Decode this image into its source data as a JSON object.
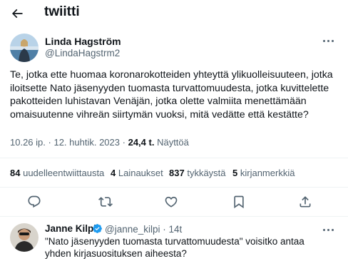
{
  "header": {
    "title": "twiitti",
    "back_icon": "arrow-left-icon"
  },
  "tweet": {
    "author": {
      "name": "Linda Hagström",
      "handle": "@LindaHagstrm2"
    },
    "text": "Te, jotka ette huomaa  koronarokotteiden yhteyttä ylikuolleisuuteen, jotka iloitsette Nato jäsenyyden tuomasta turvattomuudesta, jotka kuvittelette pakotteiden luhistavan Venäjän, jotka olette valmiita menettämään omaisuutenne vihreän siirtymän vuoksi, mitä vedätte että kestätte?",
    "time": "10.26 ip.",
    "date": "12. huhtik. 2023",
    "separator": "·",
    "views_count": "24,4 t.",
    "views_label": "Näyttöä",
    "stats": {
      "retweets_count": "84",
      "retweets_label": "uudelleentwiittausta",
      "quotes_count": "4",
      "quotes_label": "Lainaukset",
      "likes_count": "837",
      "likes_label": "tykkäystä",
      "bookmarks_count": "5",
      "bookmarks_label": "kirjanmerkkiä"
    },
    "actions": [
      "reply-icon",
      "retweet-icon",
      "like-icon",
      "bookmark-icon",
      "share-icon"
    ]
  },
  "reply": {
    "name": "Janne Kilpi",
    "handle_time": "@janne_kilpi · 14t",
    "text": "\"Nato jäsenyyden tuomasta turvattomuudesta\" voisitko antaa yhden kirjasuosituksen aiheesta?"
  },
  "colors": {
    "text": "#0f1419",
    "secondary": "#536471",
    "divider": "#eff3f4",
    "verified": "#1d9bf0"
  }
}
